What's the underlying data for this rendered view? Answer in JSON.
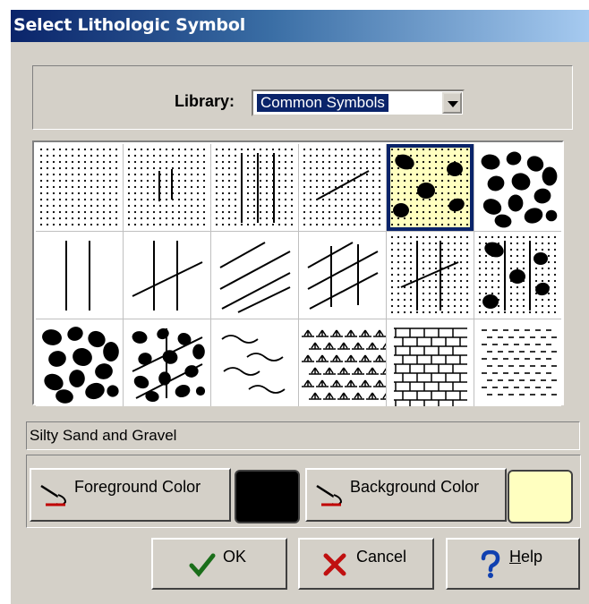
{
  "window": {
    "title": "Select Lithologic Symbol"
  },
  "library": {
    "label": "Library:",
    "selected": "Common Symbols"
  },
  "symbols": {
    "selected_index": 4,
    "names": [
      "",
      "",
      "",
      "",
      "Silty Sand and Gravel",
      "",
      "",
      "",
      "",
      "",
      "",
      "",
      "",
      "",
      "",
      "",
      "",
      ""
    ],
    "pattern_icons": [
      "dots-icon",
      "dots-short-lines-icon",
      "dots-long-lines-icon",
      "dots-diagonal-line-icon",
      "dots-blobs-icon",
      "blobs-icon",
      "vertical-lines-icon",
      "vertical-diagonal-lines-icon",
      "diagonal-lines-icon",
      "diagonal-crosshatch-icon",
      "dots-lines-diagonal-icon",
      "blobs-dots-lines-icon",
      "dense-blobs-icon",
      "blobs-diagonal-lines-icon",
      "wavy-lines-icon",
      "grass-symbols-icon",
      "brick-icon",
      "dashes-icon"
    ]
  },
  "status": {
    "text": "Silty Sand and Gravel"
  },
  "colors": {
    "foreground_label": "Foreground Color",
    "background_label": "Background Color",
    "foreground_value": "#000000",
    "background_value": "#ffffc0",
    "cell_background": "#ffffff",
    "selected_background": "#ffffc0"
  },
  "buttons": {
    "ok": "OK",
    "cancel": "Cancel",
    "help_h": "H",
    "help_rest": "elp"
  }
}
